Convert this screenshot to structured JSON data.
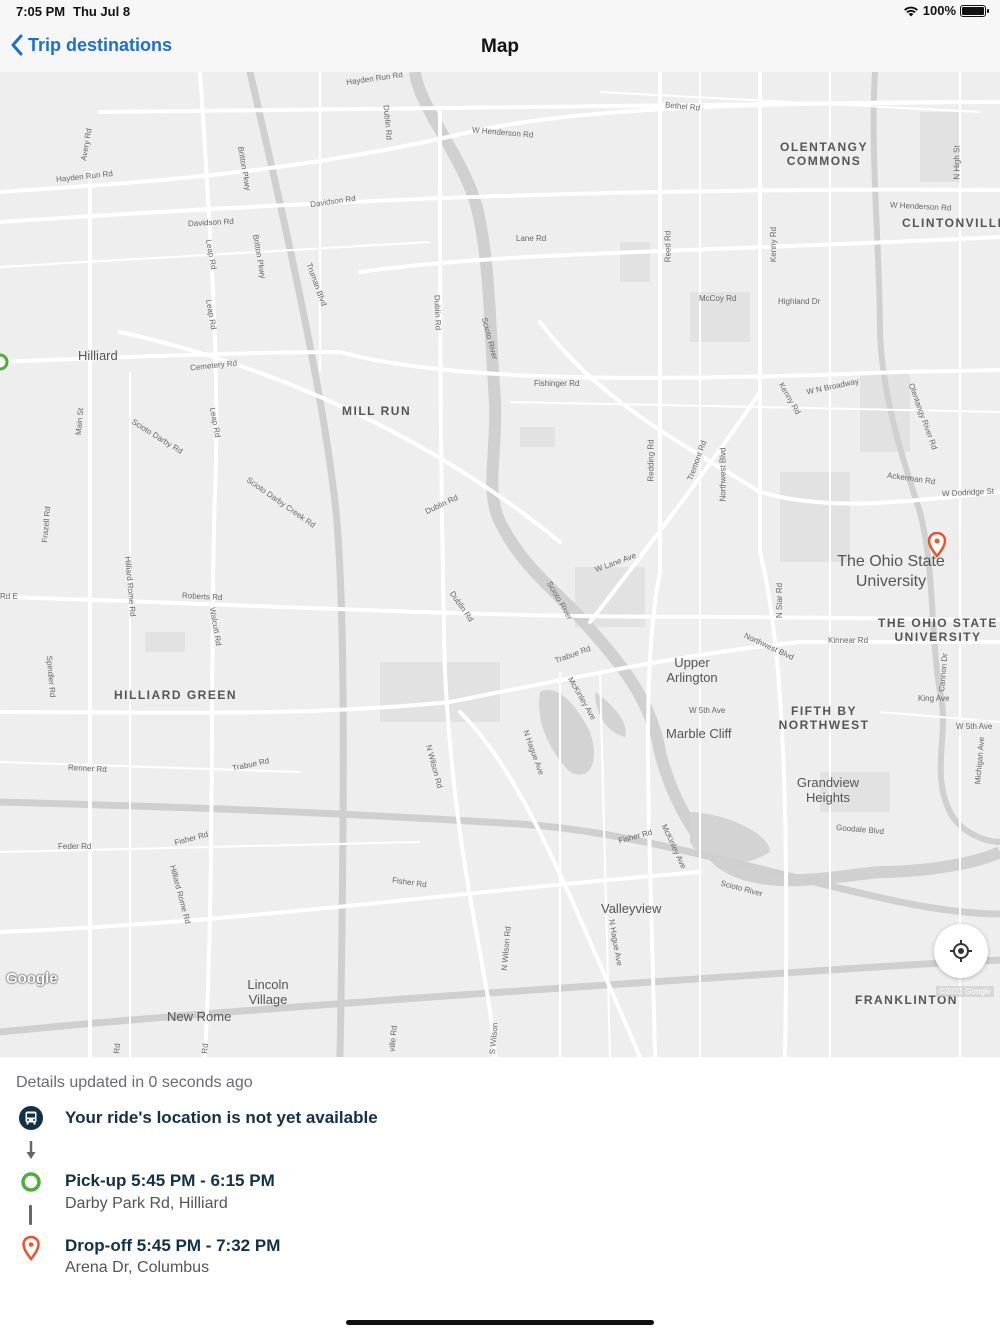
{
  "status_bar": {
    "time": "7:05 PM",
    "date": "Thu Jul 8",
    "battery": "100%",
    "wifi_icon": "wifi-icon",
    "battery_icon": "battery-icon"
  },
  "nav": {
    "back_label": "Trip destinations",
    "back_icon": "chevron-left-icon",
    "title": "Map"
  },
  "map": {
    "neighborhoods": [
      "OLENTANGY COMMONS",
      "CLINTONVILLE",
      "MILL RUN",
      "THE OHIO STATE UNIVERSITY",
      "FIFTH BY NORTHWEST",
      "HILLIARD GREEN",
      "FRANKLINTON"
    ],
    "places": [
      "Hilliard",
      "Upper Arlington",
      "Marble Cliff",
      "Grandview Heights",
      "Valleyview",
      "Lincoln Village",
      "New Rome",
      "The Ohio State University"
    ],
    "roads": [
      "Hayden Run Rd",
      "Bethel Rd",
      "W Henderson Rd",
      "Avery Rd",
      "Davidson Rd",
      "Dublin Rd",
      "Britton Pkwy",
      "Leap Rd",
      "Truman Blvd",
      "Lane Rd",
      "Reed Rd",
      "Kenny Rd",
      "N High St",
      "McCoy Rd",
      "Highland Dr",
      "Scioto River",
      "Fishinger Rd",
      "W N Broadway",
      "Cemetery Rd",
      "Scioto Darby Rd",
      "Main St",
      "Olentangy River Rd",
      "Redding Rd",
      "Tremont Rd",
      "Northwest Blvd",
      "Ackerman Rd",
      "W Dodridge St",
      "Scioto Darby Creek Rd",
      "Frazell Rd",
      "W Lane Ave",
      "Hilliard Rome Rd",
      "Roberts Rd",
      "Walcutt Rd",
      "N Star Rd",
      "Kinnear Rd",
      "Trabue Rd",
      "Cannon Dr",
      "Spindler Rd",
      "McKinley Ave",
      "W 5th Ave",
      "King Ave",
      "W 5th Ave",
      "N Hague Ave",
      "N Wilson Rd",
      "Renner Rd",
      "Trabue Rd",
      "Michigan Ave",
      "Goodale Blvd",
      "Feder Rd",
      "Fisher Rd",
      "Fisher Rd",
      "McKinley Ave",
      "Scioto River",
      "Hilliard Rome Rd",
      "N Wilson Rd",
      "N Hague Ave",
      "S Wilson",
      "ville Rd",
      "Rd",
      "Rd",
      "Rd E"
    ],
    "google_label": "Google",
    "copyright": "©2021 Google",
    "recenter_icon": "crosshair-icon",
    "pickup_marker_color": "#4caf3a",
    "dropoff_marker_color": "#e8542e"
  },
  "details": {
    "updated": "Details updated in 0 seconds ago",
    "ride_status": "Your ride's location is not yet available",
    "ride_icon": "bus-icon",
    "pickup": {
      "title": "Pick-up 5:45 PM - 6:15 PM",
      "address": "Darby Park Rd, Hilliard",
      "icon": "pickup-circle-icon",
      "color": "#4caf3a"
    },
    "dropoff": {
      "title": "Drop-off 5:45 PM - 7:32 PM",
      "address": "Arena Dr, Columbus",
      "icon": "dropoff-pin-icon",
      "color": "#e8542e"
    }
  }
}
